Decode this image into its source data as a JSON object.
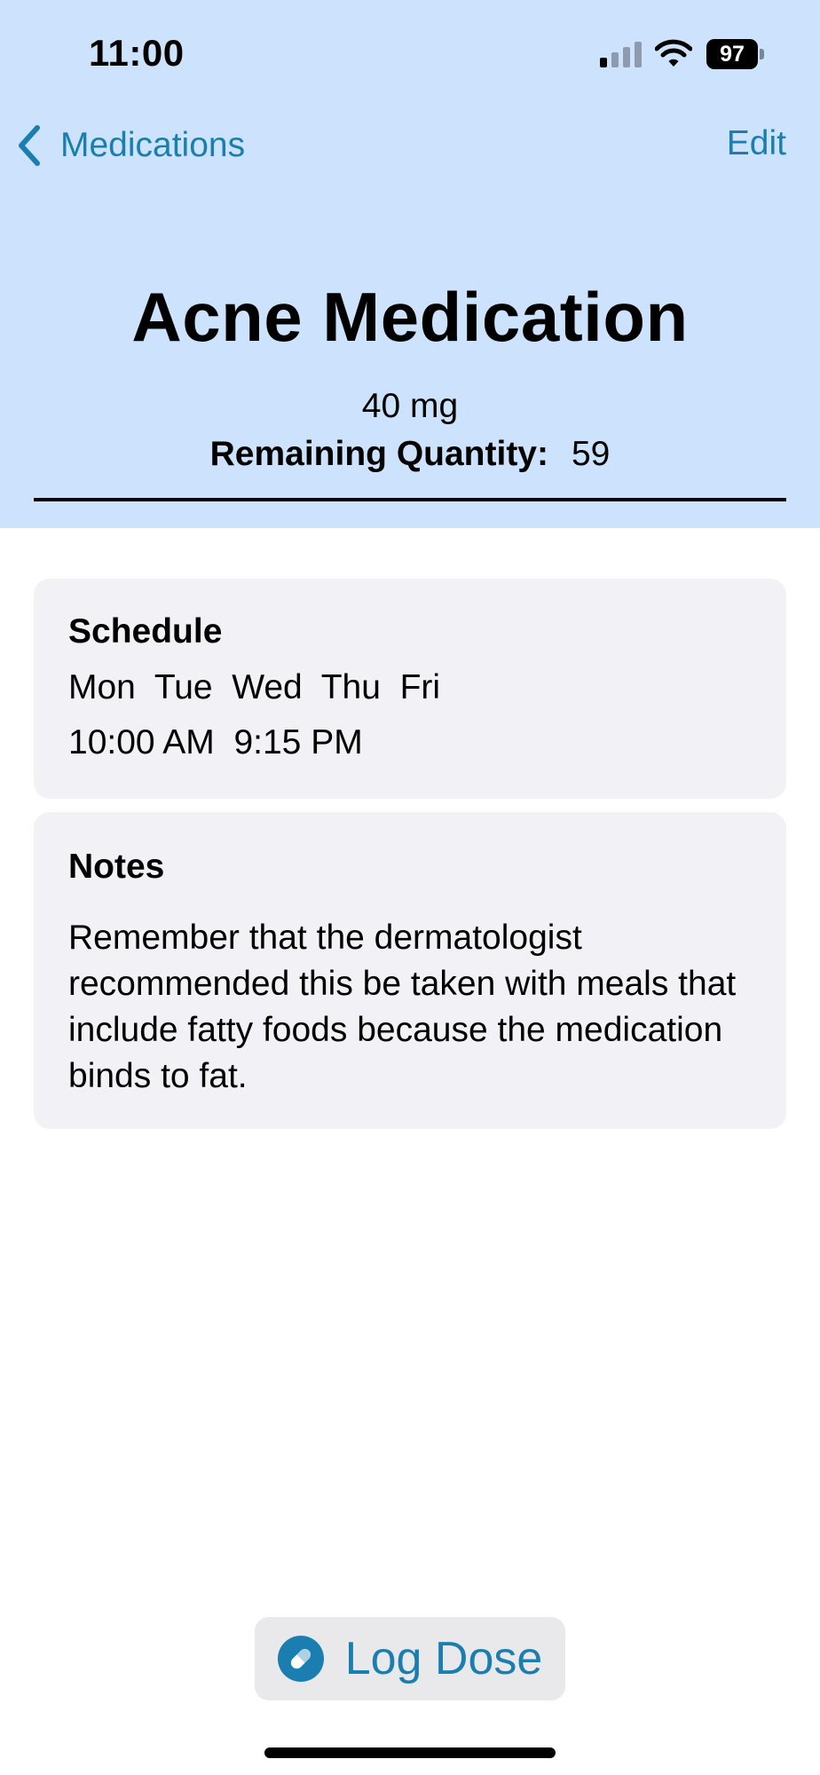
{
  "status_bar": {
    "time": "11:00",
    "battery": "97",
    "signal_bars_active": 1,
    "signal_bars_total": 4
  },
  "nav": {
    "back_label": "Medications",
    "back_icon": "chevron-left-icon",
    "edit_label": "Edit"
  },
  "medication": {
    "name": "Acne Medication",
    "dose": "40 mg",
    "remaining_label": "Remaining Quantity:",
    "remaining_value": "59"
  },
  "schedule": {
    "heading": "Schedule",
    "days": "Mon  Tue  Wed  Thu  Fri",
    "times": "10:00 AM  9:15 PM"
  },
  "notes": {
    "heading": "Notes",
    "text": "Remember that the dermatologist recommended this be taken with meals that include fatty foods because the medication binds to fat."
  },
  "action": {
    "log_label": "Log Dose",
    "icon": "pill-icon"
  },
  "colors": {
    "header_background": "#cce2fd",
    "accent": "#1a7fb0",
    "card_background": "#f1f1f6",
    "button_background": "#e9e9eb"
  }
}
